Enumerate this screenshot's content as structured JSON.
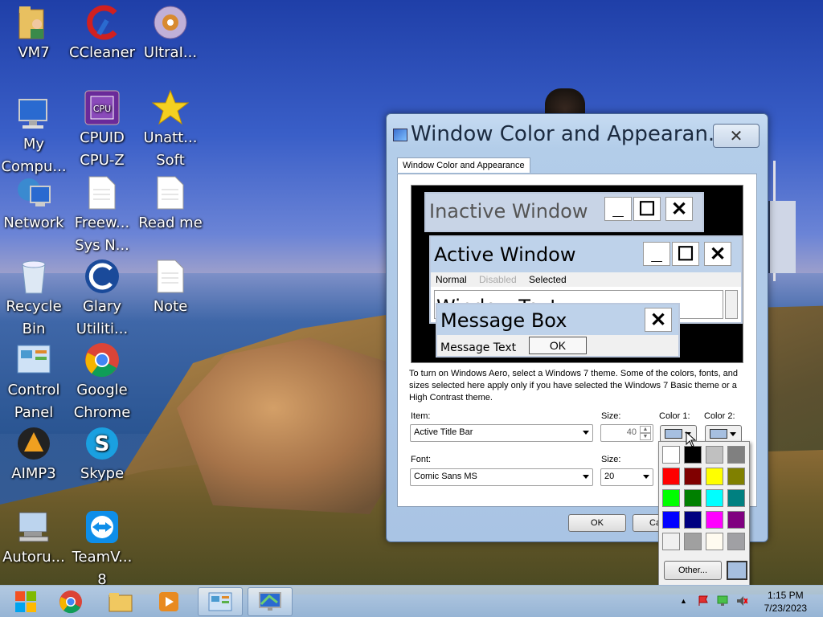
{
  "desktop": {
    "icons": [
      {
        "label": "VM7",
        "icon": "user-folder-icon"
      },
      {
        "label": "CCleaner",
        "icon": "ccleaner-icon"
      },
      {
        "label": "UltraI...",
        "icon": "disc-icon"
      },
      {
        "label": "My\nCompu...",
        "icon": "computer-icon"
      },
      {
        "label": "CPUID\nCPU-Z",
        "icon": "cpuz-icon"
      },
      {
        "label": "Unatt...\nSoft",
        "icon": "star-icon"
      },
      {
        "label": "Network",
        "icon": "network-icon"
      },
      {
        "label": "Freew...\nSys N...",
        "icon": "document-icon"
      },
      {
        "label": "Read me",
        "icon": "document-icon"
      },
      {
        "label": "Recycle\nBin",
        "icon": "recycle-bin-icon"
      },
      {
        "label": "Glary\nUtiliti...",
        "icon": "glary-icon"
      },
      {
        "label": "Note",
        "icon": "document-icon"
      },
      {
        "label": "Control\nPanel",
        "icon": "control-panel-icon"
      },
      {
        "label": "Google\nChrome",
        "icon": "chrome-icon"
      },
      {
        "label": "AIMP3",
        "icon": "aimp-icon"
      },
      {
        "label": "Skype",
        "icon": "skype-icon"
      },
      {
        "label": "Autoru...",
        "icon": "autoruns-icon"
      },
      {
        "label": "TeamV...\n8",
        "icon": "teamviewer-icon"
      }
    ]
  },
  "dialog": {
    "title": "Window Color and Appearan...",
    "close_label": "✕",
    "tab_label": "Window Color and Appearance",
    "preview": {
      "inactive_title": "Inactive Window",
      "active_title": "Active Window",
      "menu_normal": "Normal",
      "menu_disabled": "Disabled",
      "menu_selected": "Selected",
      "window_text": "Window Text",
      "message_title": "Message Box",
      "message_text": "Message Text",
      "ok_label": "OK",
      "min_glyph": "_",
      "max_glyph": "☐",
      "close_glyph": "✕"
    },
    "description": "To turn on Windows Aero, select a Windows 7 theme.  Some of the colors, fonts, and sizes selected here apply only if you have selected the Windows 7 Basic theme or a High Contrast theme.",
    "item_label": "Item:",
    "item_value": "Active Title Bar",
    "size_label": "Size:",
    "size_value": "40",
    "color1_label": "Color 1:",
    "color2_label": "Color 2:",
    "font_label": "Font:",
    "font_value": "Comic Sans MS",
    "font_size_label": "Size:",
    "font_size_value": "20",
    "ok_button": "OK",
    "cancel_button": "Ca"
  },
  "color_picker": {
    "swatches": [
      "#ffffff",
      "#000000",
      "#c0c0c0",
      "#808080",
      "#ff0000",
      "#800000",
      "#ffff00",
      "#808000",
      "#00ff00",
      "#008000",
      "#00ffff",
      "#008080",
      "#0000ff",
      "#000080",
      "#ff00ff",
      "#800080",
      "#f0f0f0",
      "#a0a0a0",
      "#fffbf0",
      "#a0a0a4"
    ],
    "other_label": "Other...",
    "current_color": "#a6bfe0"
  },
  "taskbar": {
    "items": [
      {
        "icon": "start-icon"
      },
      {
        "icon": "chrome-icon"
      },
      {
        "icon": "explorer-folder-icon"
      },
      {
        "icon": "media-player-icon"
      },
      {
        "icon": "control-panel-icon"
      },
      {
        "icon": "display-settings-icon"
      }
    ],
    "time": "1:15 PM",
    "date": "7/23/2023"
  }
}
